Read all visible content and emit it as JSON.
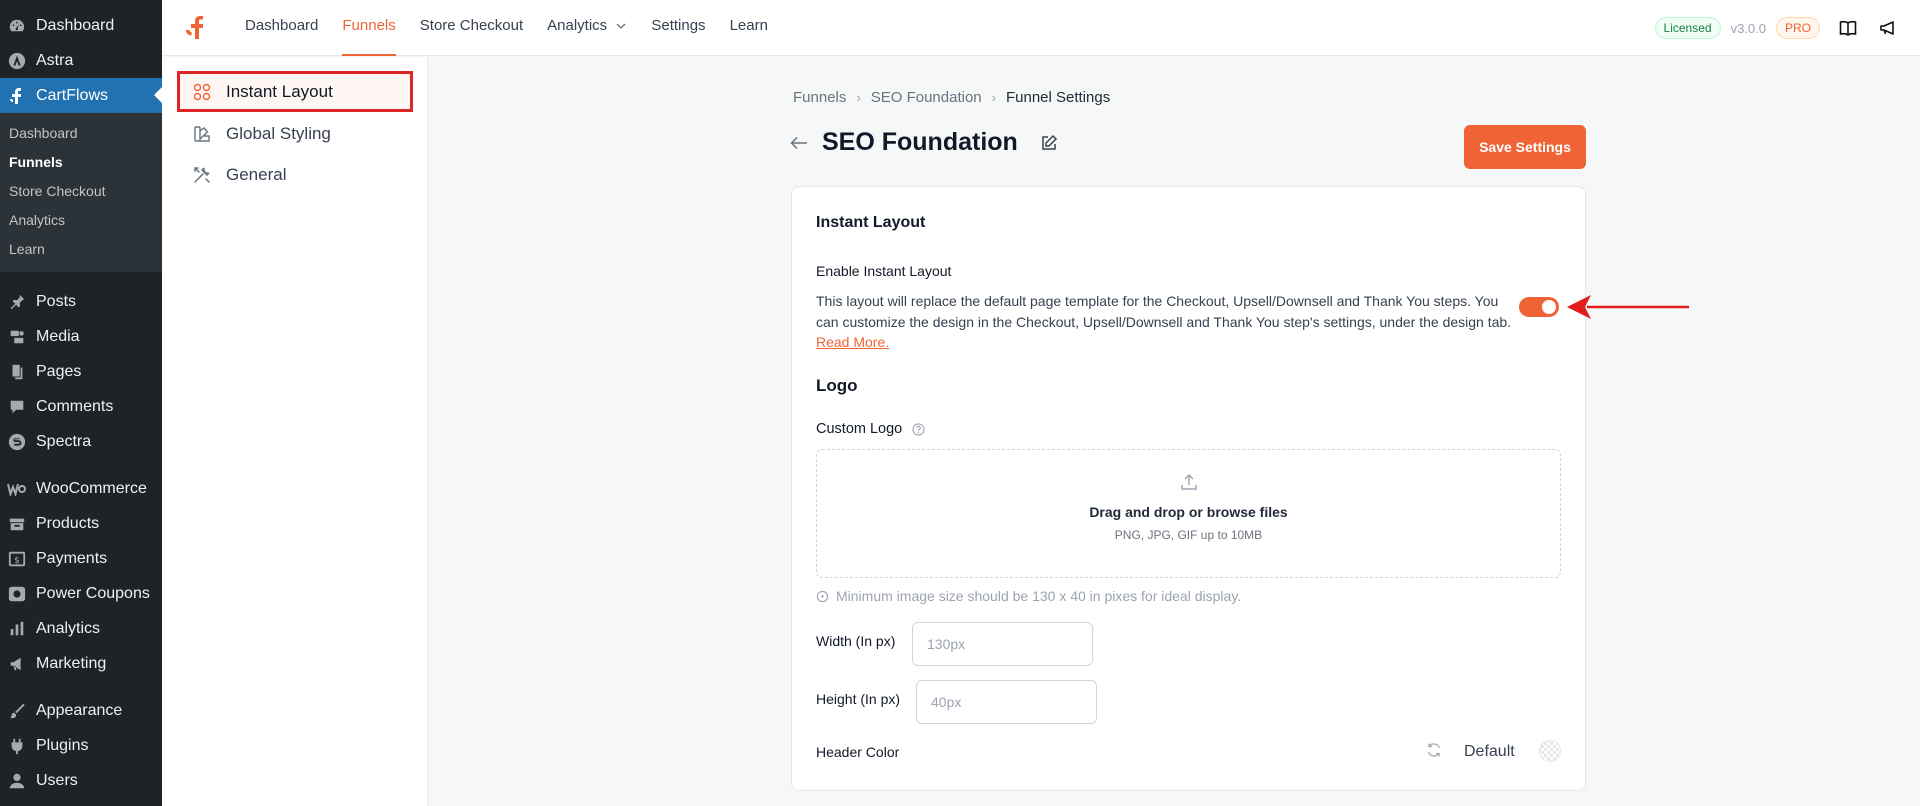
{
  "wp_sidebar": {
    "items_top": [
      {
        "label": "Dashboard",
        "icon": "dashboard-icon"
      },
      {
        "label": "Astra",
        "icon": "astra-icon"
      },
      {
        "label": "CartFlows",
        "icon": "cartflows-icon"
      }
    ],
    "submenu": [
      "Dashboard",
      "Funnels",
      "Store Checkout",
      "Analytics",
      "Learn"
    ],
    "items_bottom": [
      {
        "label": "Posts",
        "icon": "pin-icon"
      },
      {
        "label": "Media",
        "icon": "media-icon"
      },
      {
        "label": "Pages",
        "icon": "pages-icon"
      },
      {
        "label": "Comments",
        "icon": "comments-icon"
      },
      {
        "label": "Spectra",
        "icon": "spectra-icon"
      },
      {
        "label": "WooCommerce",
        "icon": "woocommerce-icon"
      },
      {
        "label": "Products",
        "icon": "products-icon"
      },
      {
        "label": "Payments",
        "icon": "payments-icon"
      },
      {
        "label": "Power Coupons",
        "icon": "coupons-icon"
      },
      {
        "label": "Analytics",
        "icon": "analytics-icon"
      },
      {
        "label": "Marketing",
        "icon": "megaphone-icon"
      },
      {
        "label": "Appearance",
        "icon": "brush-icon"
      },
      {
        "label": "Plugins",
        "icon": "plug-icon"
      },
      {
        "label": "Users",
        "icon": "user-icon"
      }
    ]
  },
  "topbar": {
    "nav": [
      "Dashboard",
      "Funnels",
      "Store Checkout",
      "Analytics",
      "Settings",
      "Learn"
    ],
    "licensed": "Licensed",
    "version": "v3.0.0",
    "pro": "PRO"
  },
  "settings_menu": [
    {
      "label": "Instant Layout",
      "icon": "grid-icon"
    },
    {
      "label": "Global Styling",
      "icon": "palette-icon"
    },
    {
      "label": "General",
      "icon": "tools-icon"
    }
  ],
  "breadcrumb": [
    "Funnels",
    "SEO Foundation",
    "Funnel Settings"
  ],
  "page_title": "SEO Foundation",
  "save_button": "Save Settings",
  "card": {
    "title": "Instant Layout",
    "enable_label": "Enable Instant Layout",
    "description": "This layout will replace the default page template for the Checkout, Upsell/Downsell and Thank You steps. You can customize the design in the Checkout, Upsell/Downsell and Thank You step's settings, under the design tab.",
    "read_more": "Read More.",
    "toggle_on": true,
    "logo_section": "Logo",
    "custom_logo_label": "Custom Logo",
    "dropzone_title": "Drag and drop or browse files",
    "dropzone_sub": "PNG, JPG, GIF up to 10MB",
    "note": "Minimum image size should be 130 x 40 in pixes for ideal display.",
    "width_label": "Width (In px)",
    "width_placeholder": "130px",
    "height_label": "Height (In px)",
    "height_placeholder": "40px",
    "header_color_label": "Header Color",
    "header_color_value": "Default"
  },
  "colors": {
    "accent": "#f06335",
    "wp_sidebar": "#1d2327",
    "wp_active": "#2271b1",
    "highlight_box": "#dc2626",
    "arrow": "#e11d1d"
  }
}
